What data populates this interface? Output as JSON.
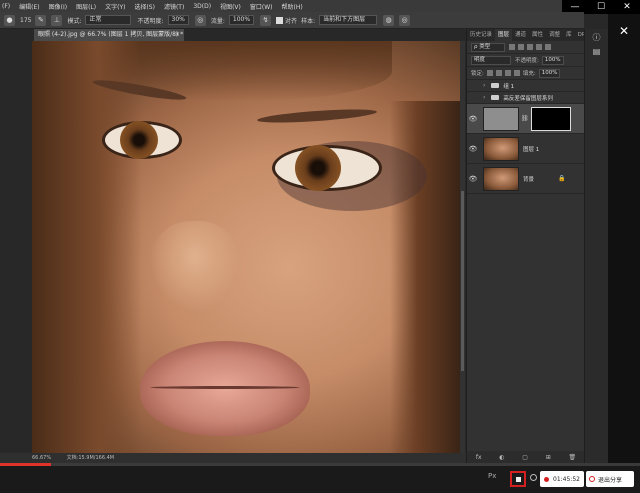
{
  "window": {
    "minimize": "—",
    "maximize": "☐",
    "close": "✕"
  },
  "menubar": [
    "(F)",
    "编辑(E)",
    "图像(I)",
    "图层(L)",
    "文字(Y)",
    "选择(S)",
    "滤镜(T)",
    "3D(D)",
    "视图(V)",
    "窗口(W)",
    "帮助(H)"
  ],
  "options": {
    "brush_size": "175",
    "mode_label": "模式:",
    "mode_value": "正常",
    "opacity_label": "不透明度:",
    "opacity_value": "30%",
    "flow_label": "流量:",
    "flow_value": "100%",
    "align_label": "对齐",
    "sample_label": "样本:",
    "sample_value": "当前和下方图层"
  },
  "doc_tab": {
    "title": "眼照 (4-2).jpg @ 66.7% (图层 1 拷贝, 图层蒙版/8) *",
    "close": "×"
  },
  "status": {
    "zoom": "66.67%",
    "doc": "文档:15.9M/166.4M"
  },
  "panel": {
    "tabs": [
      "历史记录",
      "图层",
      "通道",
      "属性",
      "调整",
      "库",
      "DRA动作"
    ],
    "active_tab": "图层",
    "filter_kind": "ρ 类型",
    "blend_mode": "明度",
    "opacity_label": "不透明度:",
    "opacity_value": "100%",
    "lock_label": "锁定:",
    "fill_label": "填充:",
    "fill_value": "100%",
    "groups": [
      {
        "name": "组 1"
      },
      {
        "name": "高反差保留图层系列"
      }
    ],
    "layers": [
      {
        "name": "",
        "type": "mask"
      },
      {
        "name": "图层 1",
        "type": "photo"
      },
      {
        "name": "背景",
        "type": "background",
        "lock": "🔒"
      }
    ],
    "bottom_icons": [
      "fx",
      "◐",
      "▢",
      "⊞",
      "🗑"
    ]
  },
  "recorder": {
    "fullscreen": "Px",
    "time": "01:45:52",
    "quit_label": "退出分享",
    "progress": 0.08
  }
}
